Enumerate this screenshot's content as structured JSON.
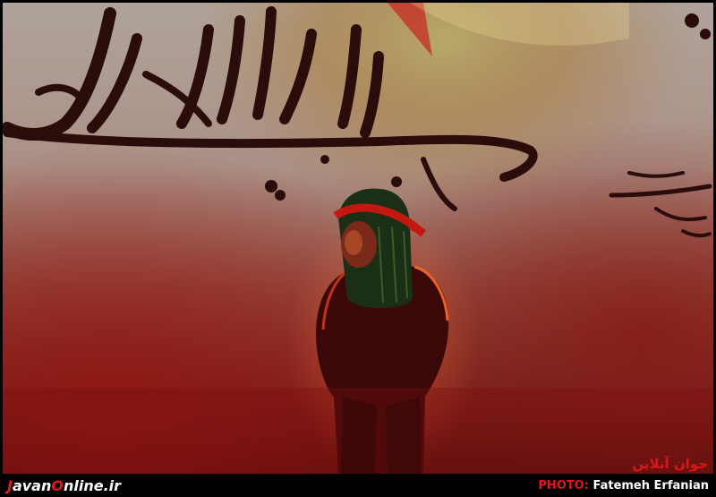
{
  "watermark": {
    "brand_first": "J",
    "brand_mid": "avan",
    "brand_o": "O",
    "brand_rest": "nline.ir"
  },
  "photo_credit": {
    "label": "PHOTO:",
    "name": "Fatemeh Erfanian"
  },
  "corner_logo_text": "جوان آنلاین",
  "colors": {
    "accent_red": "#e0171b",
    "calligraphy": "#2a0c0a"
  }
}
